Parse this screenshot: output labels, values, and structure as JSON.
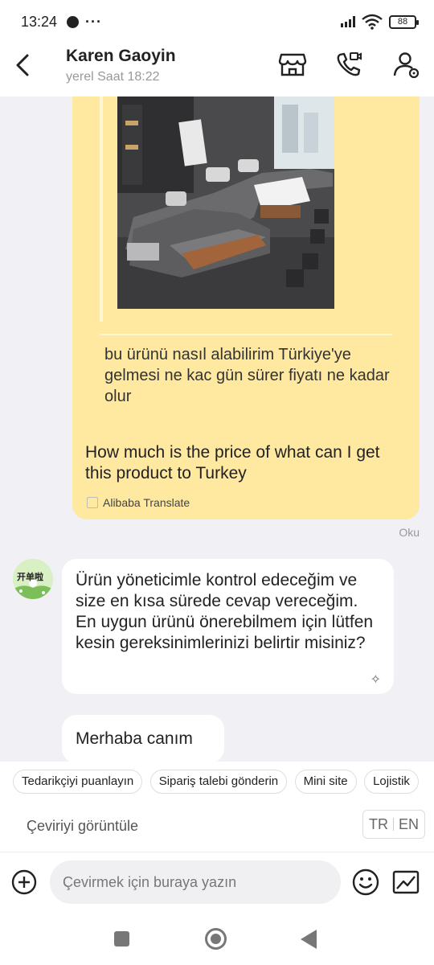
{
  "status_bar": {
    "time": "13:24",
    "more": "···",
    "battery": "88"
  },
  "header": {
    "contact_name": "Karen Gaoyin",
    "local_time": "yerel Saat 18:22",
    "icons": [
      "back-arrow-icon",
      "store-icon",
      "video-call-icon",
      "profile-icon"
    ]
  },
  "messages": {
    "sent": {
      "image_alt": "gray sectional sofa product photo",
      "original_text": "bu ürünü nasıl alabilirim Türkiye'ye gelmesi ne kac gün sürer fiyatı ne kadar olur",
      "translated_text": "How much is the price of what can I get this product to Turkey",
      "translate_credit": "Alibaba Translate",
      "read_status": "Oku"
    },
    "received": [
      {
        "text": "Ürün yöneticimle kontrol edeceğim ve size en kısa sürede cevap vereceğim. En uygun ürünü önerebilmem için lütfen kesin gereksinimlerinizi belirtir misiniz?",
        "sparkle": "✧"
      },
      {
        "text": "Merhaba canım"
      }
    ],
    "avatar_text": "开单啦"
  },
  "quick_replies": [
    "Tedarikçiyi puanlayın",
    "Sipariş talebi gönderin",
    "Mini site",
    "Lojistik"
  ],
  "translate_row": {
    "label": "Çeviriyi görüntüle",
    "lang_from": "TR",
    "lang_to": "EN"
  },
  "input": {
    "placeholder": "Çevirmek için buraya yazın"
  },
  "colors": {
    "sent_bubble": "#ffe8a0",
    "received_bubble": "#ffffff",
    "chat_background": "#f0f0f5"
  }
}
